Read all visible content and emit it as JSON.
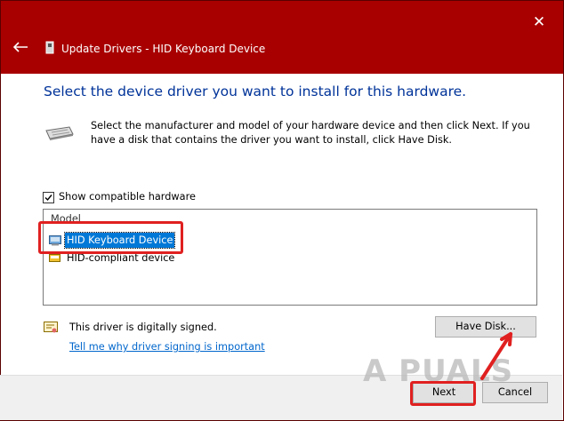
{
  "window": {
    "title": "Update Drivers - HID Keyboard Device",
    "close_glyph": "✕"
  },
  "main": {
    "heading": "Select the device driver you want to install for this hardware.",
    "description": "Select the manufacturer and model of your hardware device and then click Next. If you have a disk that contains the driver you want to install, click Have Disk.",
    "show_compatible_label": "Show compatible hardware",
    "show_compatible_checked": true,
    "model_list": {
      "header": "Model",
      "items": [
        {
          "label": "HID Keyboard Device",
          "selected": true
        },
        {
          "label": "HID-compliant device",
          "selected": false
        }
      ]
    },
    "signing": {
      "status": "This driver is digitally signed.",
      "link": "Tell me why driver signing is important"
    },
    "have_disk_label": "Have Disk..."
  },
  "footer": {
    "next_label": "Next",
    "cancel_label": "Cancel"
  },
  "watermark": "A  PUALS",
  "colors": {
    "titlebar": "#a80000",
    "heading": "#003399",
    "link": "#0066cc",
    "selection": "#0078d7",
    "highlight": "#e02020"
  },
  "icons": [
    "back-arrow-icon",
    "device-manager-icon",
    "keyboard-icon",
    "keyboard-device-icon",
    "hid-device-icon",
    "certificate-icon",
    "close-icon"
  ]
}
